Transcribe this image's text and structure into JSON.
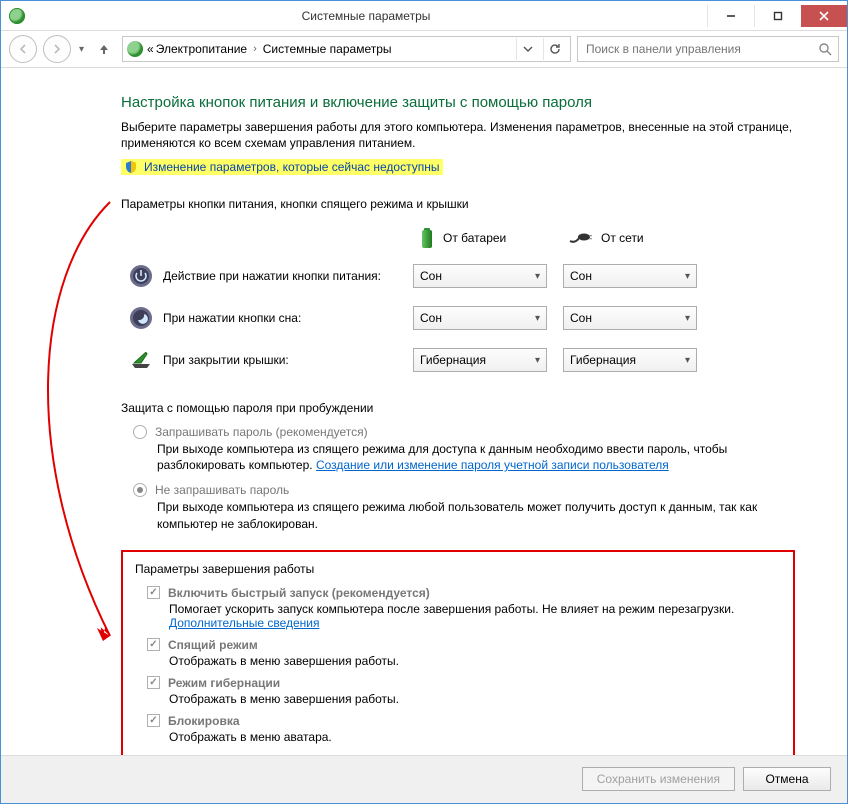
{
  "title": "Системные параметры",
  "breadcrumbs": {
    "prefix": "«",
    "a": "Электропитание",
    "b": "Системные параметры"
  },
  "search": {
    "placeholder": "Поиск в панели управления"
  },
  "header": {
    "title": "Настройка кнопок питания и включение защиты с помощью пароля",
    "desc": "Выберите параметры завершения работы для этого компьютера. Изменения параметров, внесенные на этой странице, применяются ко всем схемам управления питанием.",
    "unlock_link": "Изменение параметров, которые сейчас недоступны"
  },
  "section1": {
    "title": "Параметры кнопки питания, кнопки спящего режима и крышки",
    "col_battery": "От батареи",
    "col_ac": "От сети",
    "rows": [
      {
        "label": "Действие при нажатии кнопки питания:",
        "battery": "Сон",
        "ac": "Сон"
      },
      {
        "label": "При нажатии кнопки сна:",
        "battery": "Сон",
        "ac": "Сон"
      },
      {
        "label": "При закрытии крышки:",
        "battery": "Гибернация",
        "ac": "Гибернация"
      }
    ]
  },
  "section2": {
    "title": "Защита с помощью пароля при пробуждении",
    "opt_require": {
      "label": "Запрашивать пароль (рекомендуется)",
      "desc_a": "При выходе компьютера из спящего режима для доступа к данным необходимо ввести пароль, чтобы разблокировать компьютер. ",
      "link": "Создание или изменение пароля учетной записи пользователя"
    },
    "opt_norequire": {
      "label": "Не запрашивать пароль",
      "desc": "При выходе компьютера из спящего режима любой пользователь может получить доступ к данным, так как компьютер не заблокирован."
    }
  },
  "section3": {
    "title": "Параметры завершения работы",
    "items": [
      {
        "label": "Включить быстрый запуск (рекомендуется)",
        "desc_a": "Помогает ускорить запуск компьютера после завершения работы. Не влияет на режим перезагрузки. ",
        "link": "Дополнительные сведения"
      },
      {
        "label": "Спящий режим",
        "desc_a": "Отображать в меню завершения работы."
      },
      {
        "label": "Режим гибернации",
        "desc_a": "Отображать в меню завершения работы."
      },
      {
        "label": "Блокировка",
        "desc_a": "Отображать в меню аватара."
      }
    ]
  },
  "footer": {
    "save": "Сохранить изменения",
    "cancel": "Отмена"
  }
}
